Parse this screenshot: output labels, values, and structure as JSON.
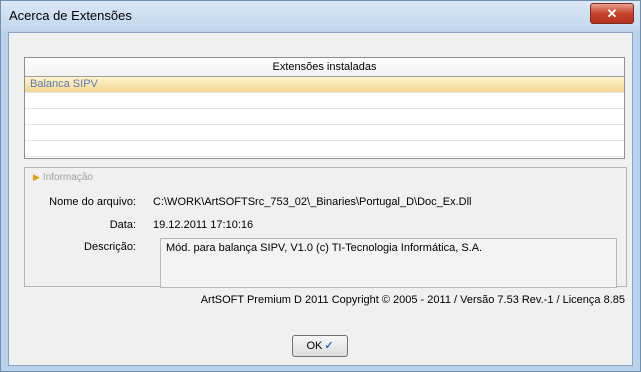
{
  "window": {
    "title": "Acerca de Extensões",
    "close_glyph": "✕"
  },
  "extensions_list": {
    "header": "Extensões instaladas",
    "items": [
      "Balanca SIPV"
    ]
  },
  "info": {
    "legend": "Informação",
    "legend_icon": "pencil-icon",
    "file_label": "Nome do arquivo:",
    "file_value": "C:\\WORK\\ArtSOFTSrc_753_02\\_Binaries\\Portugal_D\\Doc_Ex.Dll",
    "date_label": "Data:",
    "date_value": "19.12.2011 17:10:16",
    "desc_label": "Descrição:",
    "desc_value": "Mód. para balança SIPV, V1.0 (c) TI-Tecnologia Informática, S.A.",
    "copyright": "ArtSOFT Premium D 2011 Copyright © 2005 - 2011 / Versão 7.53 Rev.-1 / Licença 8.85"
  },
  "buttons": {
    "ok_label": "OK",
    "ok_icon": "✓"
  }
}
